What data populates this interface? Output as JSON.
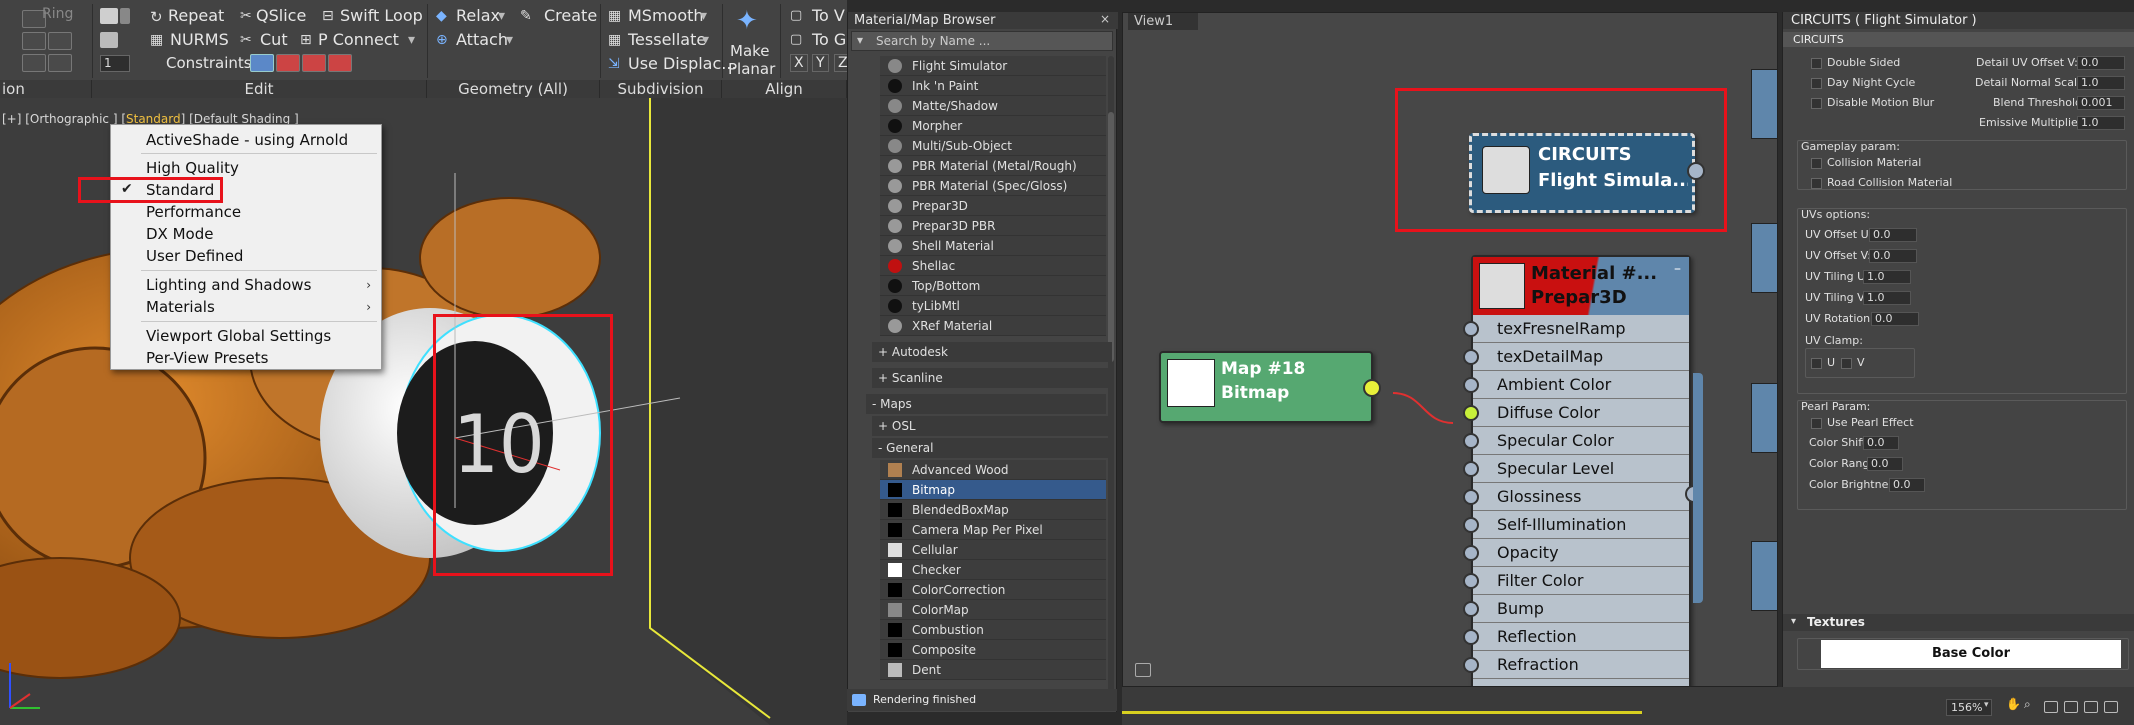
{
  "ribbon": {
    "ring": "Ring",
    "repeat": "Repeat",
    "qslice": "QSlice",
    "swift_loop": "Swift Loop",
    "nurms": "NURMS",
    "cut": "Cut",
    "p_connect": "P Connect",
    "constraints": "Constraints:",
    "relax": "Relax",
    "create": "Create",
    "attach": "Attach",
    "msmooth": "MSmooth",
    "tessellate": "Tessellate",
    "use_displace": "Use Displac...",
    "make_planar_1": "Make",
    "make_planar_2": "Planar",
    "to_v": "To V",
    "to_g": "To G",
    "x": "X",
    "y": "Y",
    "z": "Z",
    "spin_value": "1",
    "sections": {
      "left": "ion",
      "edit": "Edit",
      "geometry": "Geometry (All)",
      "subdivision": "Subdivision",
      "align": "Align"
    }
  },
  "viewport": {
    "label_pre": "[+] [Orthographic ] [",
    "label_hl": "Standard",
    "label_post": "] [Default Shading ]",
    "label_plus": "",
    "target_label": "10"
  },
  "context_menu": {
    "items": [
      "ActiveShade - using Arnold",
      "High Quality",
      "Standard",
      "Performance",
      "DX Mode",
      "User Defined",
      "Lighting and Shadows",
      "Materials",
      "Viewport Global Settings",
      "Per-View Presets"
    ],
    "checked_index": 2
  },
  "browser": {
    "title": "Material/Map Browser",
    "search_placeholder": "Search by Name ...",
    "materials": [
      "Flight Simulator",
      "Ink 'n Paint",
      "Matte/Shadow",
      "Morpher",
      "Multi/Sub-Object",
      "PBR Material (Metal/Rough)",
      "PBR Material (Spec/Gloss)",
      "Prepar3D",
      "Prepar3D PBR",
      "Shell Material",
      "Shellac",
      "Top/Bottom",
      "tyLibMtl",
      "XRef Material"
    ],
    "groups": [
      "+ Autodesk",
      "+ Scanline",
      "- Maps",
      "+ OSL",
      "- General"
    ],
    "maps": [
      "Advanced Wood",
      "Bitmap",
      "BlendedBoxMap",
      "Camera Map Per Pixel",
      "Cellular",
      "Checker",
      "ColorCorrection",
      "ColorMap",
      "Combustion",
      "Composite",
      "Dent"
    ],
    "selected_map": "Bitmap",
    "status": "Rendering finished"
  },
  "nodeview": {
    "tab": "View1",
    "circuits_title": "CIRCUITS",
    "circuits_sub": "Flight Simula...",
    "mat_title": "Material #...",
    "mat_sub": "Prepar3D",
    "map_title": "Map #18",
    "map_sub": "Bitmap",
    "slots": [
      "texFresnelRamp",
      "texDetailMap",
      "Ambient Color",
      "Diffuse Color",
      "Specular Color",
      "Specular Level",
      "Glossiness",
      "Self-Illumination",
      "Opacity",
      "Filter Color",
      "Bump",
      "Reflection",
      "Refraction"
    ]
  },
  "props": {
    "title": "CIRCUITS  ( Flight Simulator )",
    "subtitle": "CIRCUITS",
    "double_sided": "Double Sided",
    "day_night": "Day Night Cycle",
    "disable_blur": "Disable Motion Blur",
    "detail_uv_offset_v": "Detail UV Offset V:",
    "detail_uv_offset_v_val": "0.0",
    "detail_normal_scale": "Detail Normal Scale:",
    "detail_normal_scale_val": "1.0",
    "blend_threshold": "Blend Threshold:",
    "blend_threshold_val": "0.001",
    "emissive_mult": "Emissive Multiplier:",
    "emissive_mult_val": "1.0",
    "gameplay": "Gameplay param:",
    "collision": "Collision Material",
    "road_collision": "Road Collision Material",
    "uvs": "UVs options:",
    "uv_offset_u": "UV Offset U:",
    "uv_offset_v": "UV Offset V:",
    "uv_tiling_u": "UV Tiling U:",
    "uv_tiling_v": "UV Tiling V:",
    "uv_rotation": "UV Rotation:",
    "uv_offset_u_val": "0.0",
    "uv_offset_v_val": "0.0",
    "uv_tiling_u_val": "1.0",
    "uv_tiling_v_val": "1.0",
    "uv_rotation_val": "0.0",
    "uv_clamp": "UV Clamp:",
    "u": "U",
    "v": "V",
    "pearl": "Pearl Param:",
    "use_pearl": "Use Pearl Effect",
    "color_shift": "Color Shift",
    "color_range": "Color Range",
    "color_brightness": "Color Brightness",
    "color_shift_val": "0.0",
    "color_range_val": "0.0",
    "color_brightness_val": "0.0",
    "textures": "Textures",
    "base_color": "Base Color"
  },
  "bottom": {
    "zoom": "156%"
  }
}
